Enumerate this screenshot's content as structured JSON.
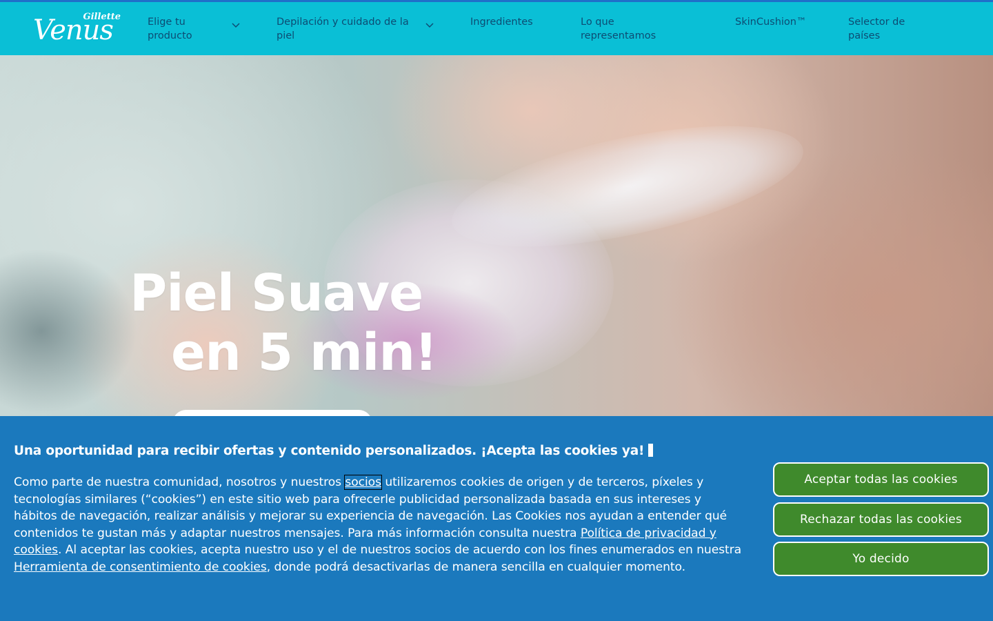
{
  "header": {
    "logo_small": "Gillette",
    "logo_big": "Venus",
    "nav": [
      {
        "label_line1": "Elige tu",
        "label_line2": "producto",
        "has_dropdown": true
      },
      {
        "label_line1": "Depilación y cuidado de la",
        "label_line2": "piel",
        "has_dropdown": true
      },
      {
        "label_line1": "Ingredientes",
        "label_line2": "",
        "has_dropdown": false
      },
      {
        "label_line1": "Lo que",
        "label_line2": "representamos",
        "has_dropdown": false
      },
      {
        "label_line1": "SkinCushion™",
        "label_line2": "",
        "has_dropdown": false
      },
      {
        "label_line1": "Selector de",
        "label_line2": "países",
        "has_dropdown": false
      }
    ]
  },
  "hero": {
    "title_line1": "Piel Suave",
    "title_line2": "en 5 min!"
  },
  "cookie_banner": {
    "title": "Una oportunidad para recibir ofertas y contenido personalizados. ¡Acepta las cookies ya!",
    "text_1": "Como parte de nuestra comunidad, nosotros y nuestros ",
    "link_partners": "socios",
    "text_2": " utilizaremos cookies de origen y de terceros, píxeles y tecnologías similares (“cookies”) en este sitio web para ofrecerle publicidad personalizada basada en sus intereses y hábitos de navegación, realizar análisis y mejorar su experiencia de navegación. Las Cookies nos ayudan a entender qué contenidos te gustan más y adaptar nuestros mensajes. Para más información consulta nuestra ",
    "link_privacy": "Política de privacidad y cookies",
    "text_3": ". Al aceptar las cookies, acepta nuestro uso y el de nuestros socios de acuerdo con los fines enumerados en nuestra ",
    "link_tool": "Herramienta de consentimiento de cookies",
    "text_4": ", donde podrá desactivarlas de manera sencilla en cualquier momento.",
    "btn_accept": "Aceptar todas las cookies",
    "btn_reject": "Rechazar todas las cookies",
    "btn_decide": "Yo decido"
  },
  "colors": {
    "nav_bg": "#0abfd6",
    "nav_text": "#0d4c73",
    "banner_bg": "#1b79bd",
    "button_bg": "#3f8a2c"
  }
}
